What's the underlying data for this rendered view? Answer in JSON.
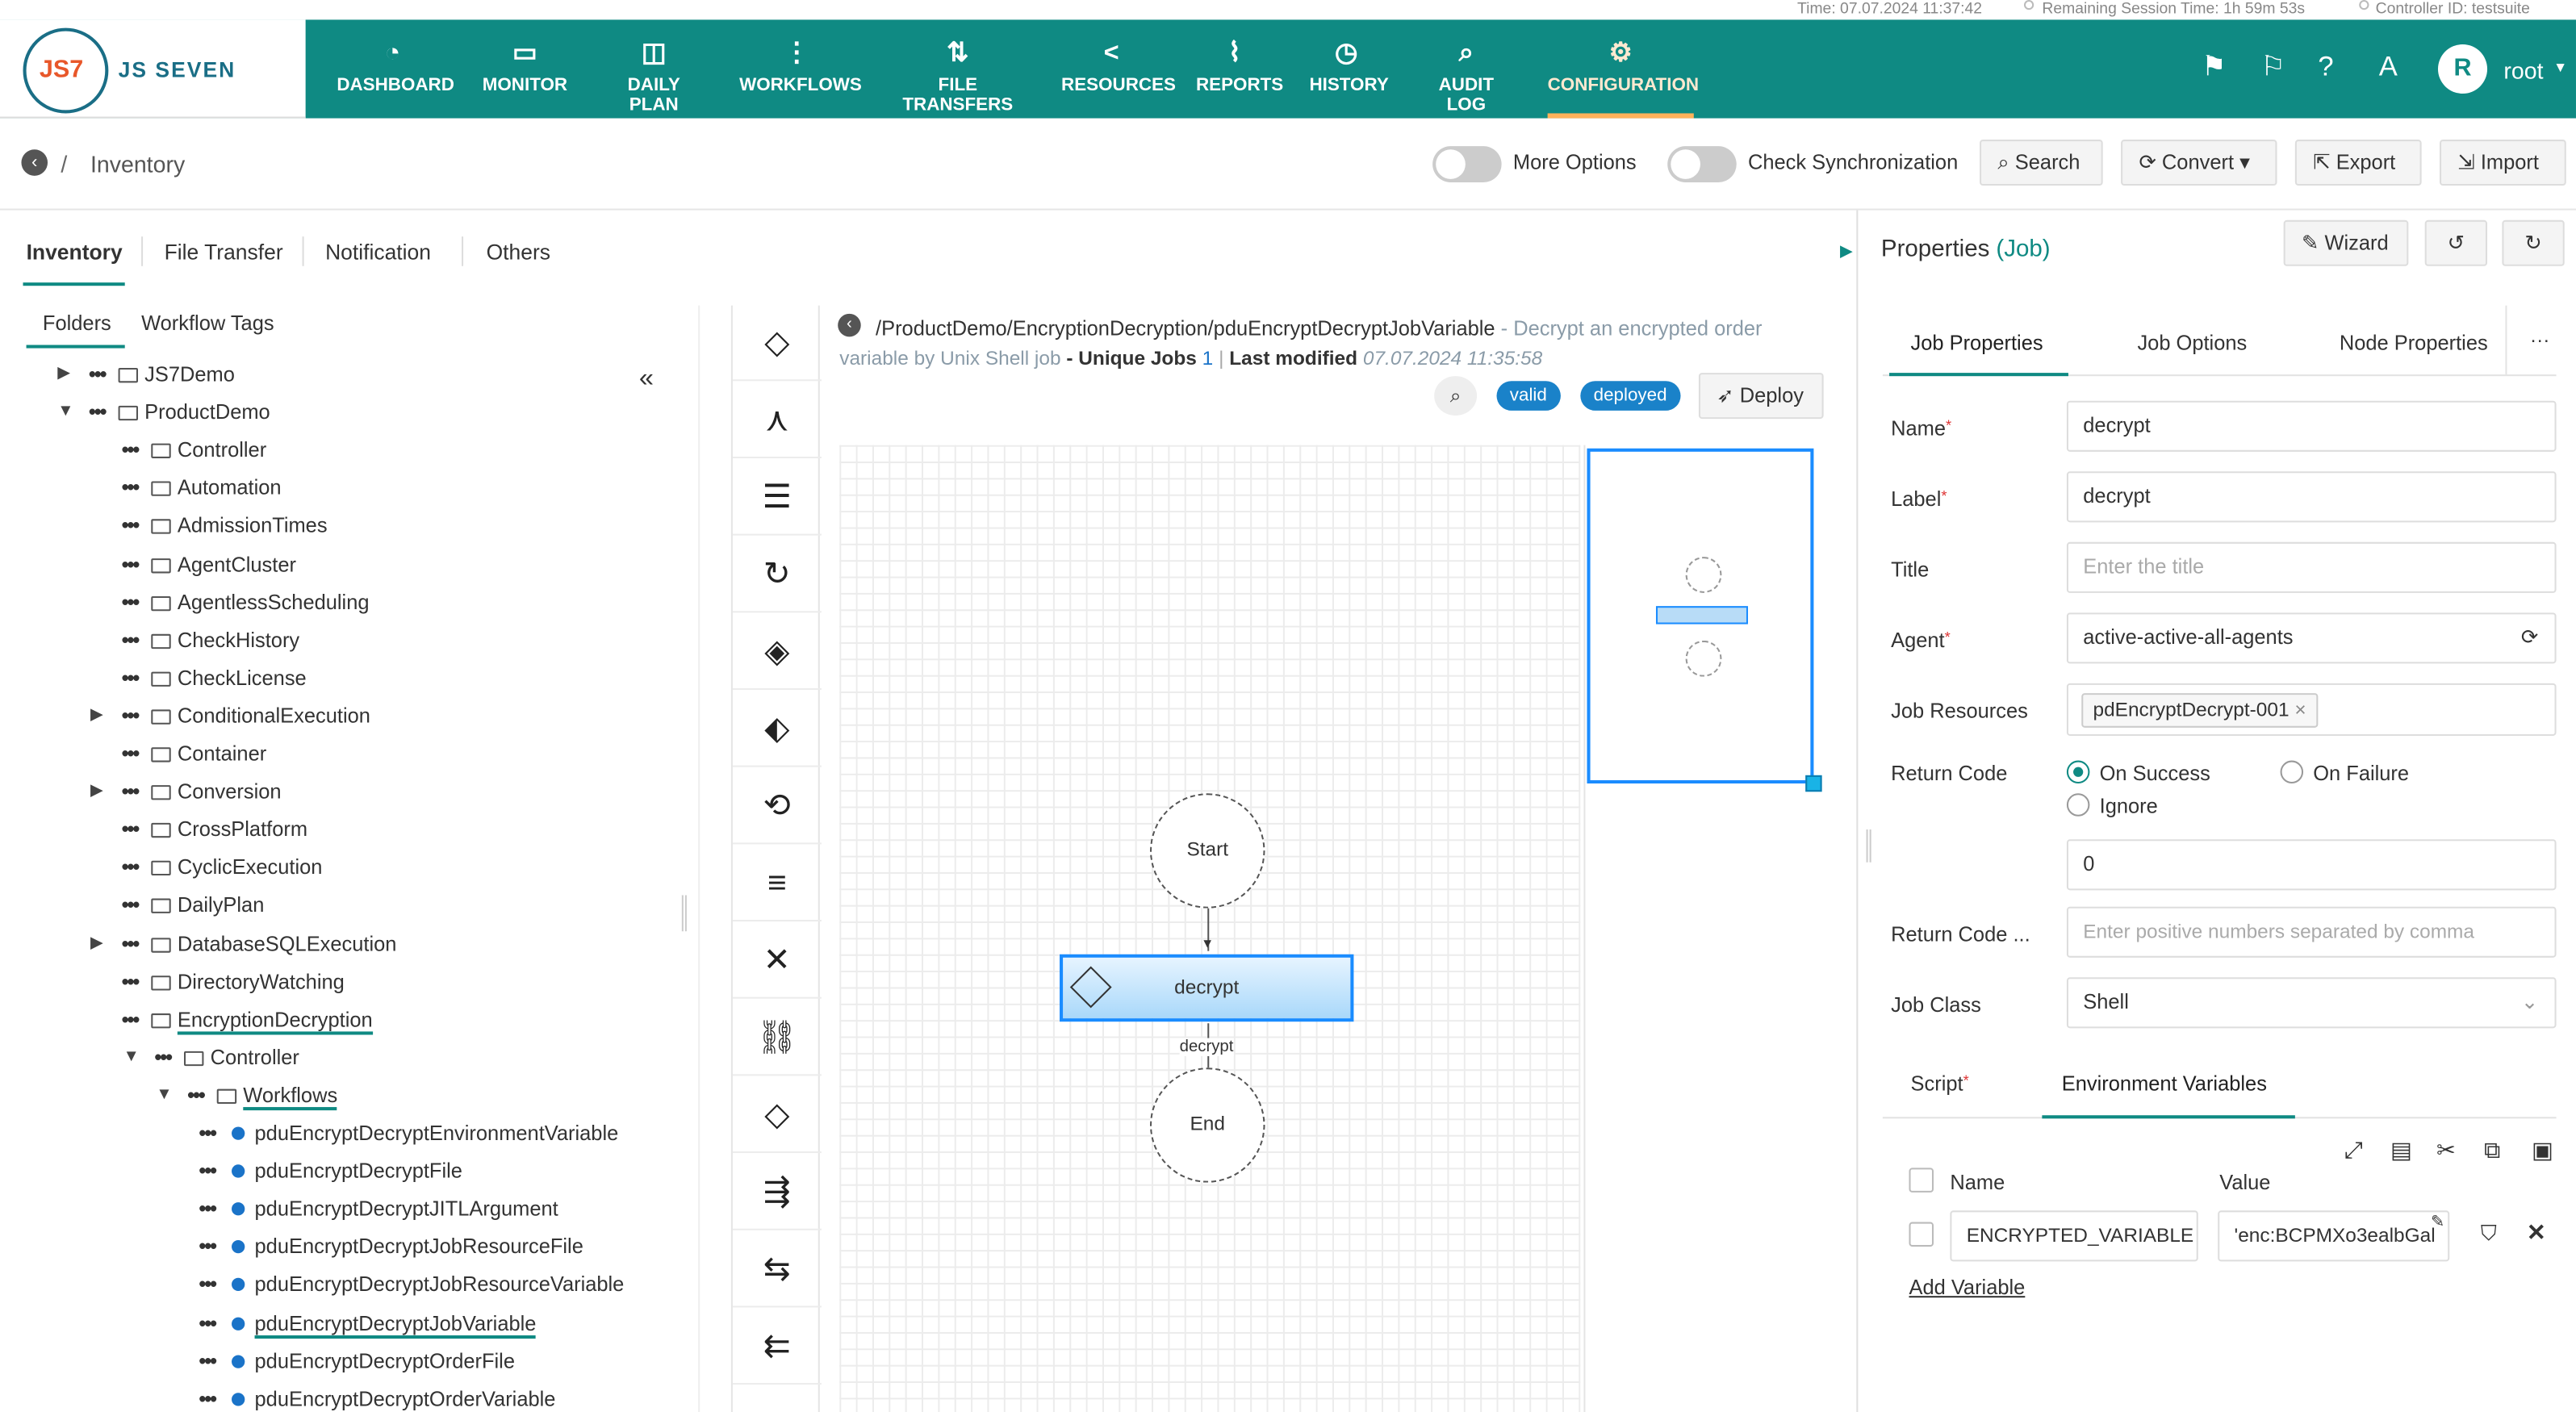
{
  "topbar": {
    "time": "Time: 07.07.2024 11:37:42",
    "session": "Remaining Session Time: 1h 59m 53s",
    "controller": "Controller ID: testsuite"
  },
  "logo": {
    "text": "JS SEVEN",
    "short": "JS7"
  },
  "nav": [
    {
      "label": "DASHBOARD",
      "icon": "dashboard-icon"
    },
    {
      "label": "MONITOR",
      "icon": "monitor-icon"
    },
    {
      "label": "DAILY PLAN",
      "icon": "calendar-icon"
    },
    {
      "label": "WORKFLOWS",
      "icon": "workflow-icon"
    },
    {
      "label": "FILE TRANSFERS",
      "icon": "transfer-icon"
    },
    {
      "label": "RESOURCES",
      "icon": "share-icon"
    },
    {
      "label": "REPORTS",
      "icon": "chart-icon"
    },
    {
      "label": "HISTORY",
      "icon": "clock-icon"
    },
    {
      "label": "AUDIT LOG",
      "icon": "audit-icon"
    },
    {
      "label": "CONFIGURATION",
      "icon": "gear-icon"
    }
  ],
  "user": {
    "initial": "R",
    "name": "root"
  },
  "breadcrumb": {
    "sep": "/",
    "title": "Inventory"
  },
  "toolbar": {
    "more_options": "More Options",
    "check_sync": "Check Synchronization",
    "search": "Search",
    "convert": "Convert",
    "export": "Export",
    "import": "Import"
  },
  "left_tabs": [
    "Inventory",
    "File Transfer",
    "Notification",
    "Others"
  ],
  "sub_tabs": [
    "Folders",
    "Workflow Tags"
  ],
  "tree": [
    {
      "label": "JS7Demo"
    },
    {
      "label": "ProductDemo"
    },
    {
      "label": "Controller"
    },
    {
      "label": "Automation"
    },
    {
      "label": "AdmissionTimes"
    },
    {
      "label": "AgentCluster"
    },
    {
      "label": "AgentlessScheduling"
    },
    {
      "label": "CheckHistory"
    },
    {
      "label": "CheckLicense"
    },
    {
      "label": "ConditionalExecution"
    },
    {
      "label": "Container"
    },
    {
      "label": "Conversion"
    },
    {
      "label": "CrossPlatform"
    },
    {
      "label": "CyclicExecution"
    },
    {
      "label": "DailyPlan"
    },
    {
      "label": "DatabaseSQLExecution"
    },
    {
      "label": "DirectoryWatching"
    },
    {
      "label": "EncryptionDecryption"
    },
    {
      "label": "Controller"
    },
    {
      "label": "Workflows"
    },
    {
      "label": "pduEncryptDecryptEnvironmentVariable"
    },
    {
      "label": "pduEncryptDecryptFile"
    },
    {
      "label": "pduEncryptDecryptJITLArgument"
    },
    {
      "label": "pduEncryptDecryptJobResourceFile"
    },
    {
      "label": "pduEncryptDecryptJobResourceVariable"
    },
    {
      "label": "pduEncryptDecryptJobVariable"
    },
    {
      "label": "pduEncryptDecryptOrderFile"
    },
    {
      "label": "pduEncryptDecryptOrderVariable"
    }
  ],
  "workflow": {
    "path": "/ProductDemo/EncryptionDecryption/pduEncryptDecryptJobVariable",
    "description": " - Decrypt an encrypted order",
    "description2": "variable by Unix Shell job",
    "unique_jobs_label": " - Unique Jobs",
    "unique_jobs": "1",
    "last_modified_label": "Last modified",
    "last_modified": "07.07.2024 11:35:58",
    "valid": "valid",
    "deployed": "deployed",
    "deploy": "Deploy"
  },
  "graph": {
    "start": "Start",
    "job": "decrypt",
    "edge_label": "decrypt",
    "end": "End"
  },
  "props": {
    "title": "Properties",
    "type": "(Job)",
    "wizard": "Wizard",
    "tabs": [
      "Job Properties",
      "Job Options",
      "Node Properties"
    ],
    "more": "···",
    "name_label": "Name",
    "name": "decrypt",
    "label_label": "Label",
    "label": "decrypt",
    "title_label": "Title",
    "title_ph": "Enter the title",
    "agent_label": "Agent",
    "agent": "active-active-all-agents",
    "resources_label": "Job Resources",
    "resource_tag": "pdEncryptDecrypt-001",
    "rc_label": "Return Code",
    "on_success": "On Success",
    "on_failure": "On Failure",
    "ignore": "Ignore",
    "rc_value": "0",
    "rc_warn_label": "Return Code ...",
    "rc_warn_ph": "Enter positive numbers separated by comma",
    "class_label": "Job Class",
    "class": "Shell",
    "script_tab": "Script",
    "env_tab": "Environment Variables",
    "col_name": "Name",
    "col_value": "Value",
    "var_name": "ENCRYPTED_VARIABLE",
    "var_value": "'enc:BCPMXo3ealbGal",
    "add_var": "Add Variable"
  },
  "colors": {
    "nav": "#0f8a83",
    "accent": "#ffb25a",
    "link": "#1a73c8"
  }
}
